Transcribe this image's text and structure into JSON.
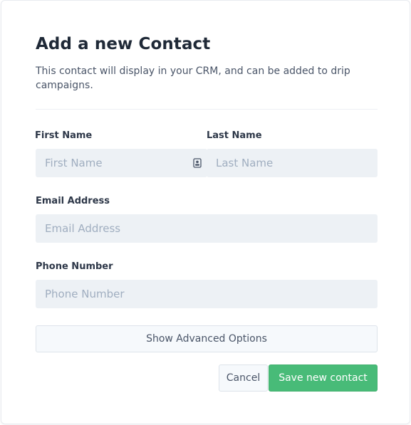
{
  "header": {
    "title": "Add a new Contact",
    "subtitle": "This contact will display in your CRM, and can be added to drip campaigns."
  },
  "form": {
    "first_name": {
      "label": "First Name",
      "placeholder": "First Name",
      "value": ""
    },
    "last_name": {
      "label": "Last Name",
      "placeholder": "Last Name",
      "value": ""
    },
    "email": {
      "label": "Email Address",
      "placeholder": "Email Address",
      "value": ""
    },
    "phone": {
      "label": "Phone Number",
      "placeholder": "Phone Number",
      "value": ""
    },
    "autofill_icon": "contact-card-icon"
  },
  "actions": {
    "advanced_label": "Show Advanced Options",
    "cancel_label": "Cancel",
    "save_label": "Save new contact"
  },
  "colors": {
    "primary": "#48bb78",
    "field_bg": "#edf1f5",
    "text": "#2d3748"
  }
}
